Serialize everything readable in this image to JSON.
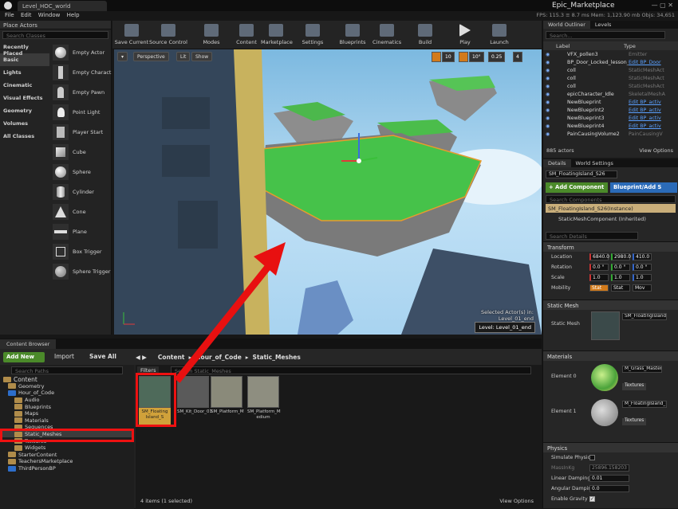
{
  "titlebar": {
    "tab": "Level_HOC_world",
    "marketplace": "Epic_Marketplace",
    "stats": "FPS: 115.3  ≡ 8.7 ms  Mem: 1,123.90 mb  Objs: 34,651"
  },
  "menu": [
    "File",
    "Edit",
    "Window",
    "Help"
  ],
  "place_actors": {
    "title": "Place Actors",
    "search": "Search Classes",
    "categories": [
      "Recently Placed",
      "Basic",
      "Lights",
      "Cinematic",
      "Visual Effects",
      "Geometry",
      "Volumes",
      "All Classes"
    ],
    "actors": [
      "Empty Actor",
      "Empty Charact",
      "Empty Pawn",
      "Point Light",
      "Player Start",
      "Cube",
      "Sphere",
      "Cylinder",
      "Cone",
      "Plane",
      "Box Trigger",
      "Sphere Trigger"
    ]
  },
  "toolbar": [
    "Save Current",
    "Source Control",
    "Modes",
    "Content",
    "Marketplace",
    "Settings",
    "Blueprints",
    "Cinematics",
    "Build",
    "Play",
    "Launch"
  ],
  "viewport": {
    "perspective": "Perspective",
    "lit": "Lit",
    "show": "Show",
    "snap1": "10",
    "snap2": "10°",
    "snap3": "0.25",
    "snap4": "4",
    "selected": "Selected Actor(s) in:",
    "selected_level": "Level_01_end",
    "level": "Level:  Level_01_end"
  },
  "outliner": {
    "tabs": [
      "World Outliner",
      "Levels"
    ],
    "search": "Search...",
    "col_label": "Label",
    "col_type": "Type",
    "rows": [
      {
        "name": "VFX_pollen3",
        "type": "Emitter",
        "link": false
      },
      {
        "name": "BP_Door_Locked_lesson_4",
        "type": "Edit BP_Door",
        "link": true
      },
      {
        "name": "coll",
        "type": "StaticMeshAct",
        "link": false
      },
      {
        "name": "coll",
        "type": "StaticMeshAct",
        "link": false
      },
      {
        "name": "coll",
        "type": "StaticMeshAct",
        "link": false
      },
      {
        "name": "epicCharacter_Idle",
        "type": "SkeletalMeshA",
        "link": false
      },
      {
        "name": "NewBlueprint",
        "type": "Edit BP_activ",
        "link": true
      },
      {
        "name": "NewBlueprint2",
        "type": "Edit BP_activ",
        "link": true
      },
      {
        "name": "NewBlueprint3",
        "type": "Edit BP_activ",
        "link": true
      },
      {
        "name": "NewBlueprint4",
        "type": "Edit BP_activ",
        "link": true
      },
      {
        "name": "PainCausingVolume2",
        "type": "PainCausingV",
        "link": false
      }
    ],
    "count": "885 actors",
    "view_options": "View Options"
  },
  "details": {
    "tabs": [
      "Details",
      "World Settings"
    ],
    "name": "SM_FloatingIsland_S26",
    "add_component": "+ Add Component",
    "blueprint": "Blueprint/Add S",
    "search_components": "Search Components",
    "instance": "SM_FloatingIsland_S26(Instance)",
    "component": "StaticMeshComponent (Inherited)",
    "search_details": "Search Details",
    "transform": "Transform",
    "location_label": "Location",
    "location": [
      "6840.0",
      "2980.0",
      "410.0"
    ],
    "rotation_label": "Rotation",
    "rotation": [
      "0.0 °",
      "0.0 °",
      "0.0 °"
    ],
    "scale_label": "Scale",
    "scale": [
      "1.0",
      "1.0",
      "1.0"
    ],
    "mobility_label": "Mobility",
    "mobility": [
      "Stat",
      "Stat",
      "Mov"
    ],
    "static_mesh_section": "Static Mesh",
    "static_mesh_label": "Static Mesh",
    "static_mesh_value": "SM_FloatingIsland",
    "materials_section": "Materials",
    "element0_label": "Element 0",
    "element0": "M_Grass_Master",
    "element1_label": "Element 1",
    "element1": "M_FloatingIsland_B",
    "textures": "Textures",
    "physics_section": "Physics",
    "simulate_label": "Simulate Physics",
    "mass_label": "MassInKg",
    "mass": "25896.158203",
    "linear_label": "Linear Damping",
    "linear": "0.01",
    "angular_label": "Angular Damping",
    "angular": "0.0",
    "gravity_label": "Enable Gravity"
  },
  "content_browser": {
    "title": "Content Browser",
    "add_new": "Add New",
    "import": "Import",
    "save_all": "Save All",
    "path": [
      "Content",
      "Hour_of_Code",
      "Static_Meshes"
    ],
    "search_paths": "Search Paths",
    "filters": "Filters",
    "search_assets": "Search Static_Meshes",
    "tree": [
      "Content",
      "Geometry",
      "Hour_of_Code",
      "Audio",
      "Blueprints",
      "Maps",
      "Materials",
      "Sequences",
      "Static_Meshes",
      "Textures",
      "Widgets",
      "StarterContent",
      "TeachersMarketplace",
      "ThirdPersonBP"
    ],
    "assets": [
      "SM_Floating Island_S",
      "SM_Kit_Door_01",
      "SM_Platform_M",
      "SM_Platform_M edium"
    ],
    "status": "4 items (1 selected)",
    "view_options": "View Options"
  }
}
